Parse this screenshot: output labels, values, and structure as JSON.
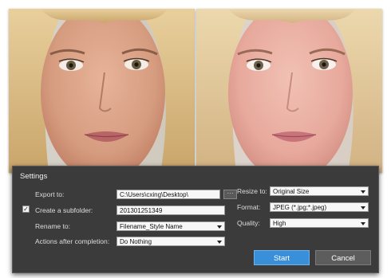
{
  "settings": {
    "title": "Settings",
    "export_to": {
      "label": "Export to:",
      "value": "C:\\Users\\cxing\\Desktop\\",
      "browse": "···"
    },
    "subfolder": {
      "label": "Create a subfolder:",
      "checked": true,
      "check_mark": "✓",
      "value": "201301251349"
    },
    "rename_to": {
      "label": "Rename to:",
      "value": "Filename_Style Name"
    },
    "actions": {
      "label": "Actions after completion:",
      "value": "Do Nothing"
    },
    "resize_to": {
      "label": "Resize to:",
      "value": "Original Size"
    },
    "format": {
      "label": "Format:",
      "value": "JPEG (*.jpg;*.jpeg)"
    },
    "quality": {
      "label": "Quality:",
      "value": "High"
    },
    "start_label": "Start",
    "cancel_label": "Cancel"
  },
  "colors": {
    "panel_bg": "#3b3b3b",
    "start_button": "#3a8fd9",
    "cancel_button": "#5d5d5d"
  }
}
